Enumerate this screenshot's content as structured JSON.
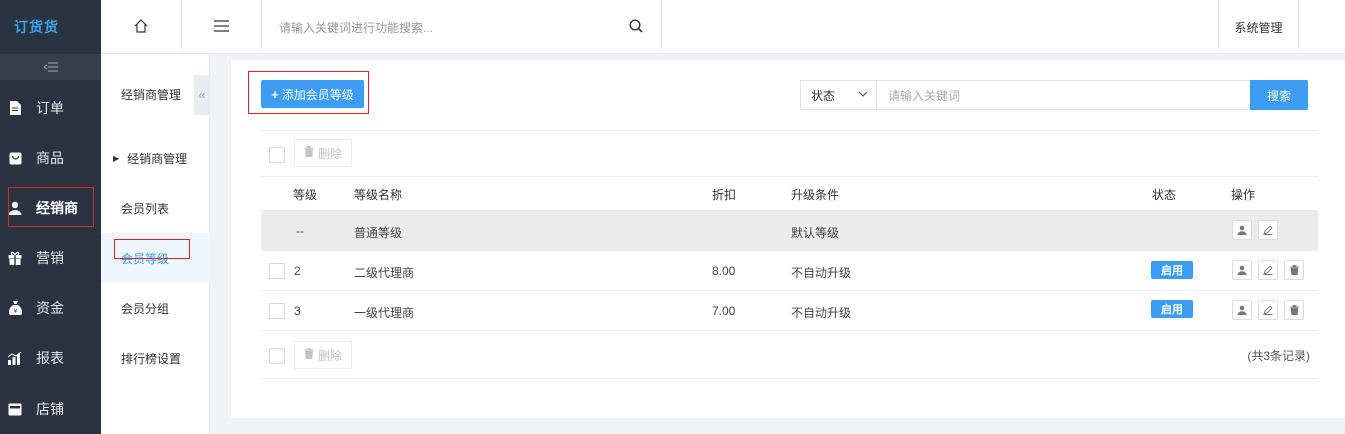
{
  "app": {
    "logo": "订货货"
  },
  "sidebar": {
    "collapse_icon": "collapse-icon",
    "items": [
      {
        "label": "订单",
        "icon": "document-icon"
      },
      {
        "label": "商品",
        "icon": "goods-icon"
      },
      {
        "label": "经销商",
        "icon": "user-icon"
      },
      {
        "label": "营销",
        "icon": "gift-icon"
      },
      {
        "label": "资金",
        "icon": "money-bag-icon"
      },
      {
        "label": "报表",
        "icon": "chart-icon"
      },
      {
        "label": "店铺",
        "icon": "shop-icon"
      }
    ]
  },
  "topbar": {
    "search_placeholder": "请输入关键词进行功能搜索...",
    "system_menu": "系统管理"
  },
  "subnav": {
    "title": "经销商管理",
    "toggle": "«",
    "items": [
      {
        "label": "经销商管理"
      },
      {
        "label": "会员列表"
      },
      {
        "label": "会员等级"
      },
      {
        "label": "会员分组"
      },
      {
        "label": "排行榜设置"
      }
    ]
  },
  "toolbar": {
    "add_button": "添加会员等级",
    "status_select": "状态",
    "keyword_placeholder": "请输入关键词",
    "search_button": "搜索",
    "delete_button": "删除"
  },
  "table": {
    "headers": {
      "level": "等级",
      "name": "等级名称",
      "discount": "折扣",
      "condition": "升级条件",
      "status": "状态",
      "actions": "操作"
    },
    "rows": [
      {
        "level": "--",
        "name": "普通等级",
        "discount": "",
        "condition": "默认等级",
        "status": ""
      },
      {
        "level": "2",
        "name": "二级代理商",
        "discount": "8.00",
        "condition": "不自动升级",
        "status": "启用"
      },
      {
        "level": "3",
        "name": "一级代理商",
        "discount": "7.00",
        "condition": "不自动升级",
        "status": "启用"
      }
    ],
    "record_count": "(共3条记录)"
  },
  "colors": {
    "sidebar_bg": "#2a3340",
    "accent": "#3d9df2",
    "highlight_border": "#e0242f"
  }
}
